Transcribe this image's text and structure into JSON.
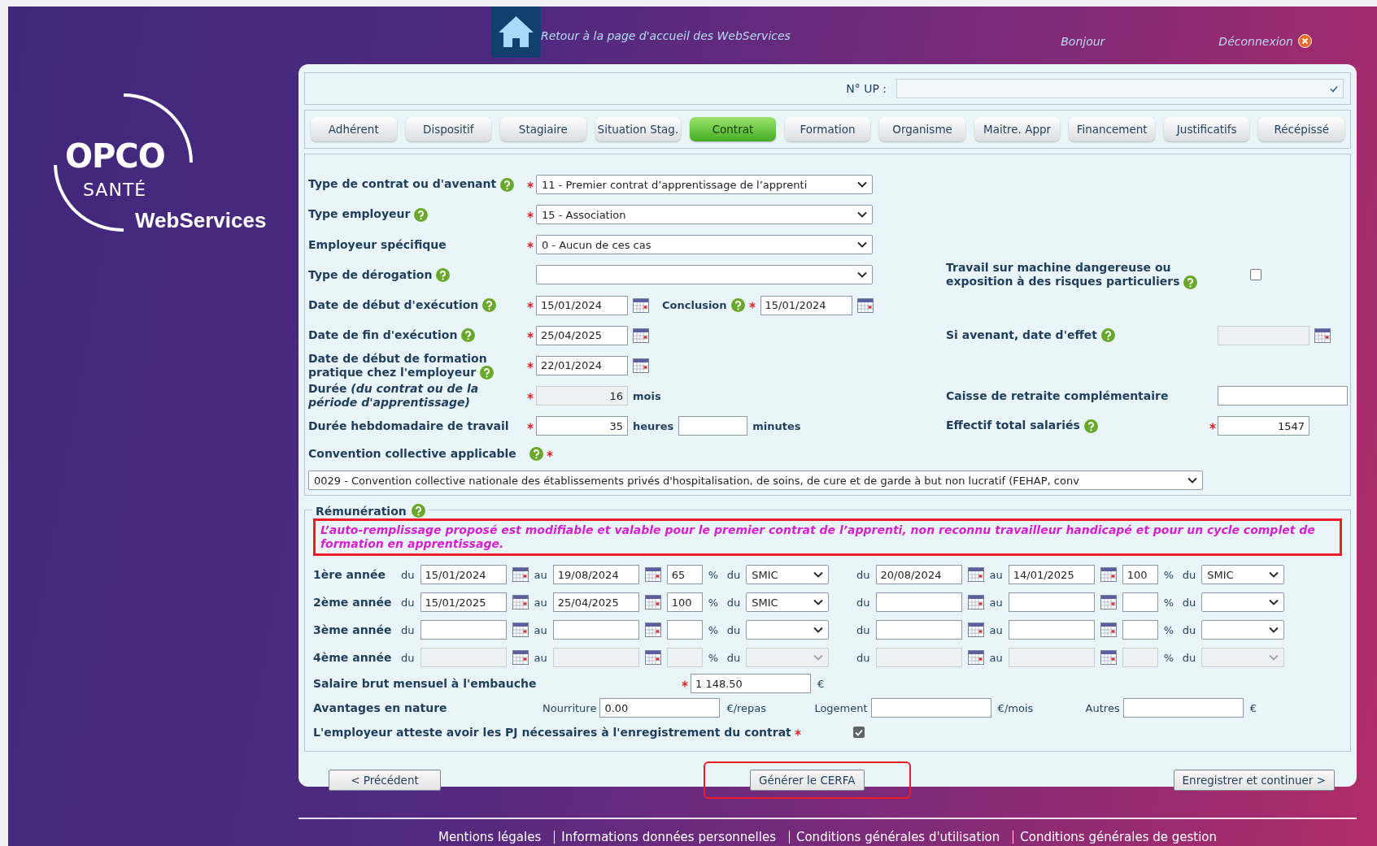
{
  "header": {
    "home_link": "Retour à la page d'accueil des WebServices",
    "greeting": "Bonjour",
    "logout": "Déconnexion"
  },
  "logo": {
    "brand": "OPCO",
    "sub": "SANTÉ",
    "product": "WebServices"
  },
  "up_field": {
    "label": "N° UP :"
  },
  "tabs": [
    {
      "label": "Adhérent",
      "selected": false
    },
    {
      "label": "Dispositif",
      "selected": false
    },
    {
      "label": "Stagiaire",
      "selected": false
    },
    {
      "label": "Situation Stag.",
      "selected": false
    },
    {
      "label": "Contrat",
      "selected": true
    },
    {
      "label": "Formation",
      "selected": false
    },
    {
      "label": "Organisme",
      "selected": false
    },
    {
      "label": "Maitre. Appr",
      "selected": false
    },
    {
      "label": "Financement",
      "selected": false
    },
    {
      "label": "Justificatifs",
      "selected": false
    },
    {
      "label": "Récépissé",
      "selected": false
    }
  ],
  "contract": {
    "rows": [
      {
        "label": "Type de contrat ou d'avenant",
        "help": true,
        "required": true,
        "kind": "select",
        "value": "11 - Premier contrat d’apprentissage de l’apprenti"
      },
      {
        "label": "Type employeur",
        "help": true,
        "required": true,
        "kind": "select",
        "value": "15 - Association"
      },
      {
        "label": "Employeur spécifique",
        "help": false,
        "required": true,
        "kind": "select",
        "value": "0 - Aucun de ces cas"
      },
      {
        "label": "Type de dérogation",
        "help": true,
        "required": false,
        "kind": "select",
        "right": {
          "kind": "checkbox",
          "label": "Travail sur machine dangereuse ou exposition à des risques particuliers",
          "help": true,
          "required": false,
          "checked": false
        }
      },
      {
        "label": "Date de début d'exécution",
        "help": true,
        "required": true,
        "kind": "date",
        "value": "15/01/2024",
        "extra": {
          "label": "Conclusion",
          "help": true,
          "required": true,
          "value": "15/01/2024"
        }
      },
      {
        "label": "Date de fin d'exécution",
        "help": true,
        "required": true,
        "kind": "date",
        "value": "25/04/2025",
        "right": {
          "kind": "date",
          "label": "Si avenant, date d'effet",
          "help": true,
          "required": false,
          "disabled": true
        }
      },
      {
        "label": "Date de début de formation pratique chez l'employeur",
        "help": true,
        "required": true,
        "kind": "date",
        "value": "22/01/2024"
      },
      {
        "label": "Durée *(du contrat ou de la période d'apprentissage)*",
        "help": false,
        "required": true,
        "kind": "number",
        "value": "16",
        "unit": "mois",
        "disabled": true,
        "right": {
          "kind": "text",
          "label": "Caisse de retraite complémentaire",
          "help": false,
          "required": false
        }
      },
      {
        "label": "Durée hebdomadaire de travail",
        "help": false,
        "required": true,
        "kind": "hours",
        "value": "35",
        "unit": "heures",
        "unit2": "minutes",
        "right": {
          "kind": "number",
          "label": "Effectif total salariés",
          "help": true,
          "required": true,
          "value": "1547"
        }
      }
    ],
    "convention": {
      "label": "Convention collective applicable",
      "help": true,
      "required": true,
      "value": "0029 - Convention collective nationale des établissements privés d'hospitalisation, de soins, de cure et de garde à but non lucratif (FEHAP, conv"
    }
  },
  "remuneration": {
    "legend": "Rémunération",
    "help": true,
    "notice": {
      "text": "L’auto-remplissage proposé est modifiable et valable pour le premier contrat de l’apprenti, non reconnu travailleur handicapé et pour un cycle complet de formation en apprentissage.",
      "highlighted": true
    },
    "years": [
      {
        "label": "1ère année",
        "disabled": false,
        "periods": [
          {
            "from_word": "du",
            "from": "15/01/2024",
            "to_word": "au",
            "to": "19/08/2024",
            "rate": "65",
            "rate_unit": "%",
            "base_word": "du",
            "base": "SMIC"
          },
          {
            "from_word": "du",
            "from": "20/08/2024",
            "to_word": "au",
            "to": "14/01/2025",
            "rate": "100",
            "rate_unit": "%",
            "base_word": "du",
            "base": "SMIC"
          }
        ]
      },
      {
        "label": "2ème année",
        "disabled": false,
        "periods": [
          {
            "from_word": "du",
            "from": "15/01/2025",
            "to_word": "au",
            "to": "25/04/2025",
            "rate": "100",
            "rate_unit": "%",
            "base_word": "du",
            "base": "SMIC"
          },
          {
            "from_word": "du",
            "to_word": "au",
            "rate_unit": "%",
            "base_word": "du"
          }
        ]
      },
      {
        "label": "3ème année",
        "disabled": false,
        "periods": [
          {
            "from_word": "du",
            "to_word": "au",
            "rate_unit": "%",
            "base_word": "du"
          },
          {
            "from_word": "du",
            "to_word": "au",
            "rate_unit": "%",
            "base_word": "du"
          }
        ]
      },
      {
        "label": "4ème année",
        "disabled": true,
        "periods": [
          {
            "from_word": "du",
            "to_word": "au",
            "rate_unit": "%",
            "base_word": "du"
          },
          {
            "from_word": "du",
            "to_word": "au",
            "rate_unit": "%",
            "base_word": "du"
          }
        ]
      }
    ],
    "salary": {
      "label": "Salaire brut mensuel à l'embauche",
      "required": true,
      "value": "1 148.50",
      "unit": "€"
    },
    "benefits": {
      "label": "Avantages en nature",
      "items": [
        {
          "label": "Nourriture",
          "value": "0.00",
          "unit": "€/repas"
        },
        {
          "label": "Logement",
          "unit": "€/mois"
        },
        {
          "label": "Autres",
          "unit": "€"
        }
      ]
    },
    "attest": {
      "label": "L'employeur atteste avoir les PJ nécessaires à l'enregistrement du contrat",
      "required": true,
      "checked": true
    }
  },
  "actions": {
    "previous": "< Précédent",
    "generate": {
      "label": "Générer le CERFA",
      "highlighted": true
    },
    "next": "Enregistrer et continuer >"
  },
  "footer_links": [
    "Mentions légales",
    "Informations données personnelles",
    "Conditions générales d'utilisation",
    "Conditions générales de gestion"
  ]
}
